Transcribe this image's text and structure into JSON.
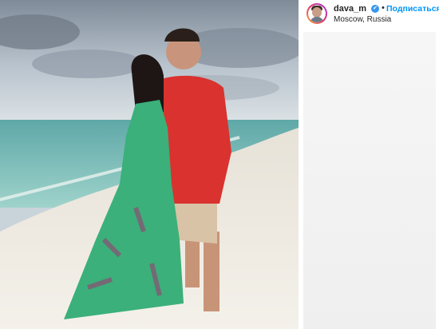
{
  "post": {
    "username": "dava_m",
    "verified_mark": "✔",
    "separator": "•",
    "follow_label": "Подписаться",
    "location": "Moscow, Russia"
  },
  "icons": {
    "verified": "verified-badge-icon",
    "avatar": "profile-avatar"
  },
  "colors": {
    "link_blue": "#0095f6",
    "verified_blue": "#3897f0",
    "text_dark": "#262626",
    "dress_green": "#3bb07a",
    "shirt_red": "#d9322f"
  }
}
